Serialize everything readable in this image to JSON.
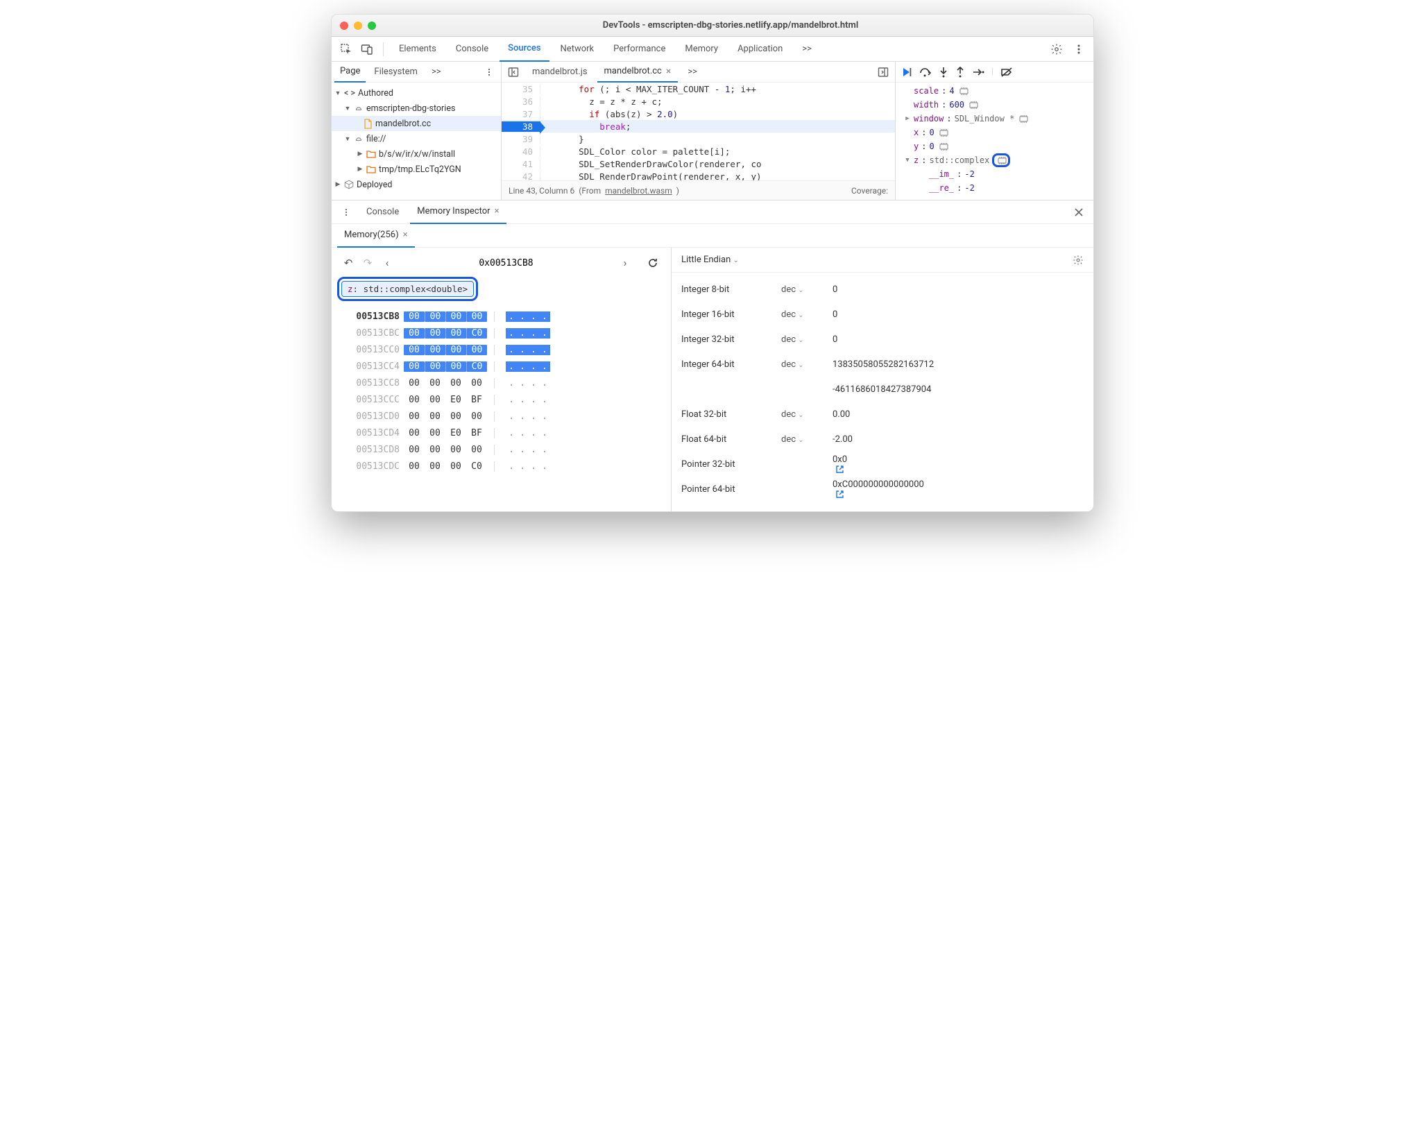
{
  "window": {
    "title": "DevTools - emscripten-dbg-stories.netlify.app/mandelbrot.html"
  },
  "mainTabs": {
    "items": [
      "Elements",
      "Console",
      "Sources",
      "Network",
      "Performance",
      "Memory",
      "Application"
    ],
    "more": ">>",
    "activeIndex": 2
  },
  "sidebar": {
    "tabs": {
      "items": [
        "Page",
        "Filesystem"
      ],
      "more": ">>"
    },
    "tree": {
      "authored": "Authored",
      "repo": "emscripten-dbg-stories",
      "file": "mandelbrot.cc",
      "fileScheme": "file://",
      "folder1": "b/s/w/ir/x/w/install",
      "folder2": "tmp/tmp.ELcTq2YGN",
      "deployed": "Deployed"
    }
  },
  "editor": {
    "tabs": {
      "t0": "mandelbrot.js",
      "t1": "mandelbrot.cc",
      "more": ">>"
    },
    "lines": [
      {
        "n": 35,
        "t": "      for (; i < MAX_ITER_COUNT - 1; i++"
      },
      {
        "n": 36,
        "t": "        z = z * z + c;"
      },
      {
        "n": 37,
        "t": "        if (abs(z) > 2.0)"
      },
      {
        "n": 38,
        "t": "          break;",
        "hl": true
      },
      {
        "n": 39,
        "t": "      }"
      },
      {
        "n": 40,
        "t": "      SDL_Color color = palette[i];"
      },
      {
        "n": 41,
        "t": "      SDL_SetRenderDrawColor(renderer, co"
      },
      {
        "n": 42,
        "t": "      SDL_RenderDrawPoint(renderer, x, y)"
      }
    ],
    "status": {
      "pos": "Line 43, Column 6",
      "from": "(From ",
      "wasm": "mandelbrot.wasm",
      "close": ")",
      "cov": "Coverage:"
    }
  },
  "scope": {
    "rows": [
      {
        "k": "scale",
        "v": "4",
        "mem": true
      },
      {
        "k": "width",
        "v": "600",
        "mem": true
      },
      {
        "k": "window",
        "t": "SDL_Window *",
        "mem": true,
        "arrow": "▶"
      },
      {
        "k": "x",
        "v": "0",
        "mem": true
      },
      {
        "k": "y",
        "v": "0",
        "mem": true
      },
      {
        "k": "z",
        "t": "std::complex<double>",
        "mem": true,
        "arrow": "▼",
        "boxedMem": true
      },
      {
        "k": "__im_",
        "v": "-2",
        "indent": true
      },
      {
        "k": "__re_",
        "v": "-2",
        "indent": true
      }
    ]
  },
  "drawer": {
    "tabs": {
      "console": "Console",
      "mi": "Memory Inspector"
    }
  },
  "mem": {
    "tab": "Memory(256)",
    "address": "0x00513CB8",
    "chip": {
      "name": "z",
      "type": "std::complex<double>"
    },
    "rows": [
      {
        "addr": "00513CB8",
        "b": [
          "00",
          "00",
          "00",
          "00"
        ],
        "hl": true,
        "bold": true
      },
      {
        "addr": "00513CBC",
        "b": [
          "00",
          "00",
          "00",
          "C0"
        ],
        "hl": true
      },
      {
        "addr": "00513CC0",
        "b": [
          "00",
          "00",
          "00",
          "00"
        ],
        "hl": true
      },
      {
        "addr": "00513CC4",
        "b": [
          "00",
          "00",
          "00",
          "C0"
        ],
        "hl": true
      },
      {
        "addr": "00513CC8",
        "b": [
          "00",
          "00",
          "00",
          "00"
        ]
      },
      {
        "addr": "00513CCC",
        "b": [
          "00",
          "00",
          "E0",
          "BF"
        ]
      },
      {
        "addr": "00513CD0",
        "b": [
          "00",
          "00",
          "00",
          "00"
        ]
      },
      {
        "addr": "00513CD4",
        "b": [
          "00",
          "00",
          "E0",
          "BF"
        ]
      },
      {
        "addr": "00513CD8",
        "b": [
          "00",
          "00",
          "00",
          "00"
        ]
      },
      {
        "addr": "00513CDC",
        "b": [
          "00",
          "00",
          "00",
          "C0"
        ]
      }
    ],
    "endian": "Little Endian",
    "values": [
      {
        "type": "Integer 8-bit",
        "fmt": "dec",
        "val": "0"
      },
      {
        "type": "Integer 16-bit",
        "fmt": "dec",
        "val": "0"
      },
      {
        "type": "Integer 32-bit",
        "fmt": "dec",
        "val": "0"
      },
      {
        "type": "Integer 64-bit",
        "fmt": "dec",
        "val": "13835058055282163712"
      },
      {
        "type": "",
        "fmt": "",
        "val": "-4611686018427387904"
      },
      {
        "type": "Float 32-bit",
        "fmt": "dec",
        "val": "0.00"
      },
      {
        "type": "Float 64-bit",
        "fmt": "dec",
        "val": "-2.00"
      },
      {
        "type": "Pointer 32-bit",
        "fmt": "",
        "val": "0x0",
        "ext": true
      },
      {
        "type": "Pointer 64-bit",
        "fmt": "",
        "val": "0xC000000000000000",
        "ext": true
      }
    ]
  }
}
